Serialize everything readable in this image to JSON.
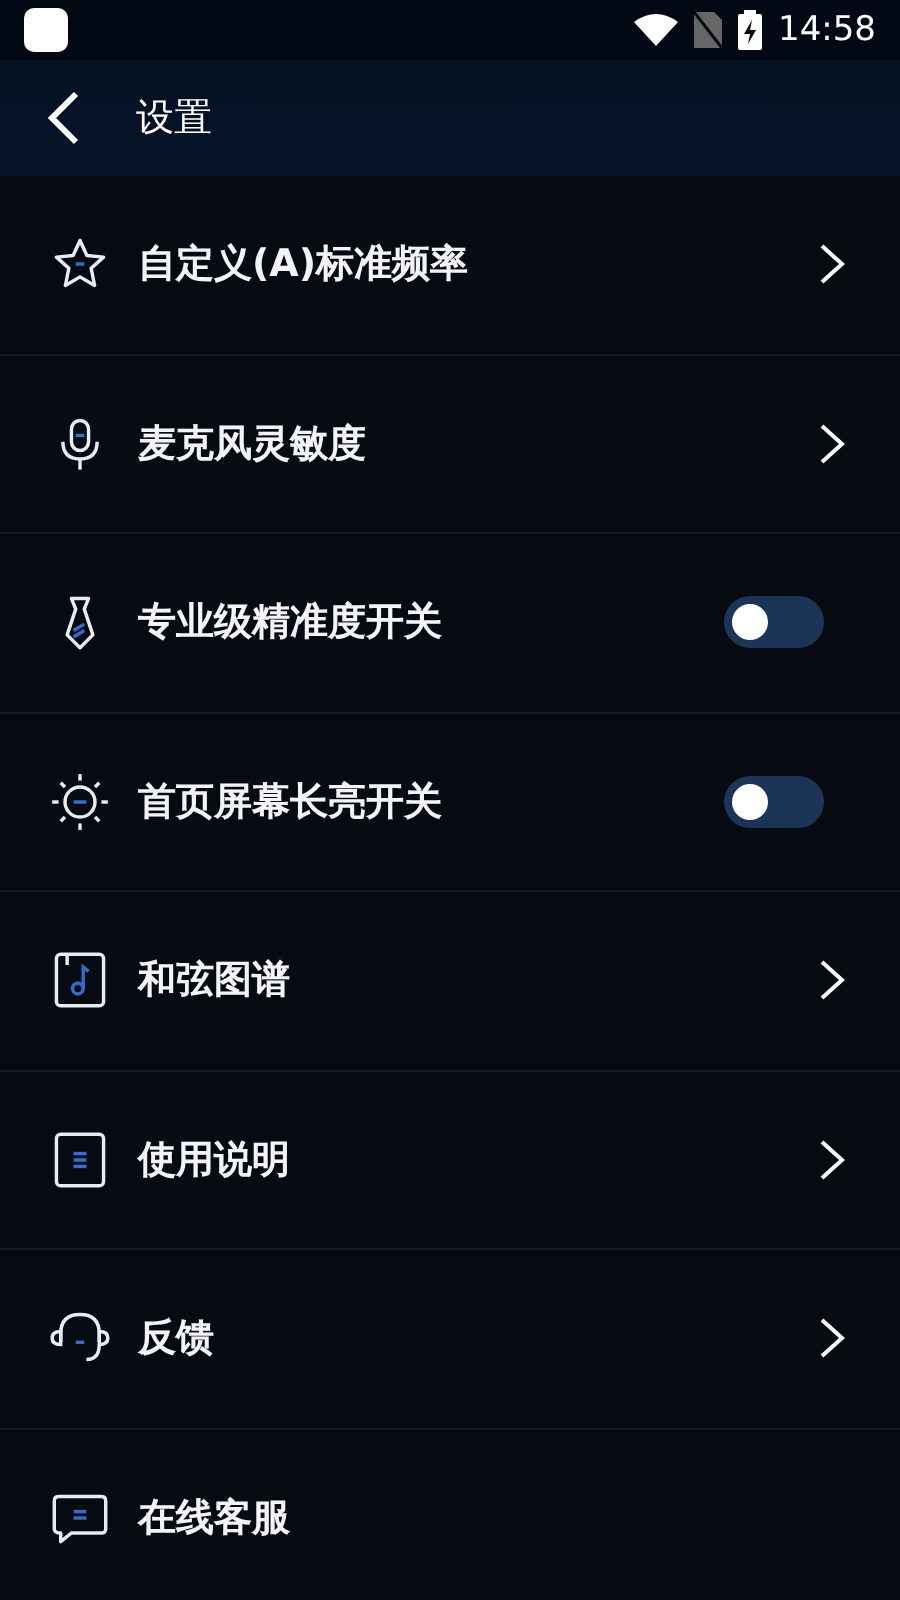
{
  "status_bar": {
    "time": "14:58"
  },
  "header": {
    "title": "设置"
  },
  "rows": [
    {
      "label": "自定义(A)标准频率",
      "kind": "link"
    },
    {
      "label": "麦克风灵敏度",
      "kind": "link"
    },
    {
      "label": "专业级精准度开关",
      "kind": "toggle",
      "on": false
    },
    {
      "label": "首页屏幕长亮开关",
      "kind": "toggle",
      "on": false
    },
    {
      "label": "和弦图谱",
      "kind": "link"
    },
    {
      "label": "使用说明",
      "kind": "link"
    },
    {
      "label": "反馈",
      "kind": "link"
    },
    {
      "label": "在线客服",
      "kind": "plain"
    }
  ]
}
